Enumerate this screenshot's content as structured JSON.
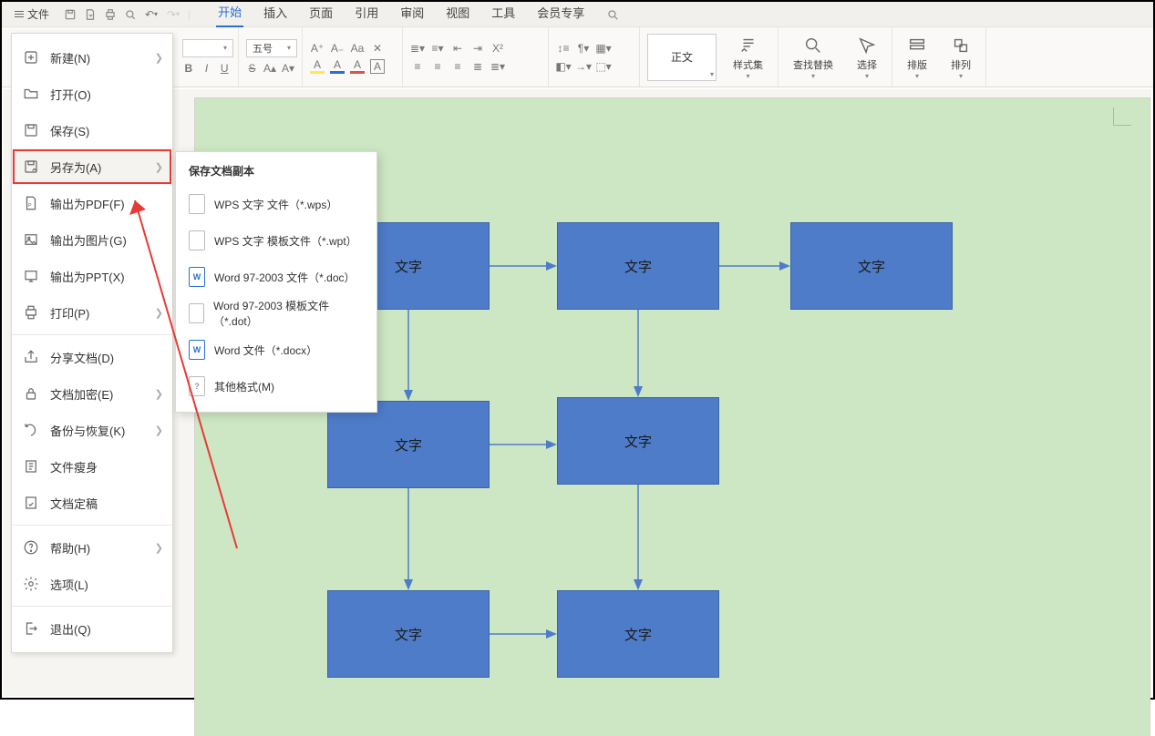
{
  "menubar": {
    "file_label": "文件",
    "tabs": [
      "开始",
      "插入",
      "页面",
      "引用",
      "审阅",
      "视图",
      "工具",
      "会员专享"
    ],
    "active_tab_index": 0
  },
  "ribbon": {
    "font_size": "五号",
    "style_preview": "正文",
    "style_group": "样式集",
    "find_replace": "查找替换",
    "select": "选择",
    "layout": "排版",
    "arrange": "排列"
  },
  "filemenu": {
    "items": [
      {
        "label": "新建(N)",
        "icon": "plus",
        "arrow": true
      },
      {
        "label": "打开(O)",
        "icon": "folder",
        "arrow": false
      },
      {
        "label": "保存(S)",
        "icon": "save",
        "arrow": false
      },
      {
        "label": "另存为(A)",
        "icon": "saveas",
        "arrow": true,
        "highlight": true
      },
      {
        "label": "输出为PDF(F)",
        "icon": "pdf",
        "arrow": false
      },
      {
        "label": "输出为图片(G)",
        "icon": "image",
        "arrow": false
      },
      {
        "label": "输出为PPT(X)",
        "icon": "ppt",
        "arrow": false
      },
      {
        "label": "打印(P)",
        "icon": "print",
        "arrow": true
      },
      {
        "label": "分享文档(D)",
        "icon": "share",
        "arrow": false,
        "sep_before": true
      },
      {
        "label": "文档加密(E)",
        "icon": "lock",
        "arrow": true
      },
      {
        "label": "备份与恢复(K)",
        "icon": "backup",
        "arrow": true
      },
      {
        "label": "文件瘦身",
        "icon": "slim",
        "arrow": false
      },
      {
        "label": "文档定稿",
        "icon": "final",
        "arrow": false
      },
      {
        "label": "帮助(H)",
        "icon": "help",
        "arrow": true,
        "sep_before": true
      },
      {
        "label": "选项(L)",
        "icon": "gear",
        "arrow": false
      },
      {
        "label": "退出(Q)",
        "icon": "exit",
        "arrow": false,
        "sep_before": true
      }
    ]
  },
  "saveas_submenu": {
    "header": "保存文档副本",
    "items": [
      {
        "label": "WPS 文字 文件（*.wps）",
        "badge": "",
        "cls": "gray"
      },
      {
        "label": "WPS 文字 模板文件（*.wpt）",
        "badge": "",
        "cls": "gray"
      },
      {
        "label": "Word 97-2003 文件（*.doc）",
        "badge": "W",
        "cls": "blue"
      },
      {
        "label": "Word 97-2003 模板文件（*.dot）",
        "badge": "",
        "cls": "gray"
      },
      {
        "label": "Word 文件（*.docx）",
        "badge": "W",
        "cls": "blue"
      },
      {
        "label": "其他格式(M)",
        "badge": "?",
        "cls": "gray"
      }
    ]
  },
  "flow": {
    "box_label": "文字"
  }
}
